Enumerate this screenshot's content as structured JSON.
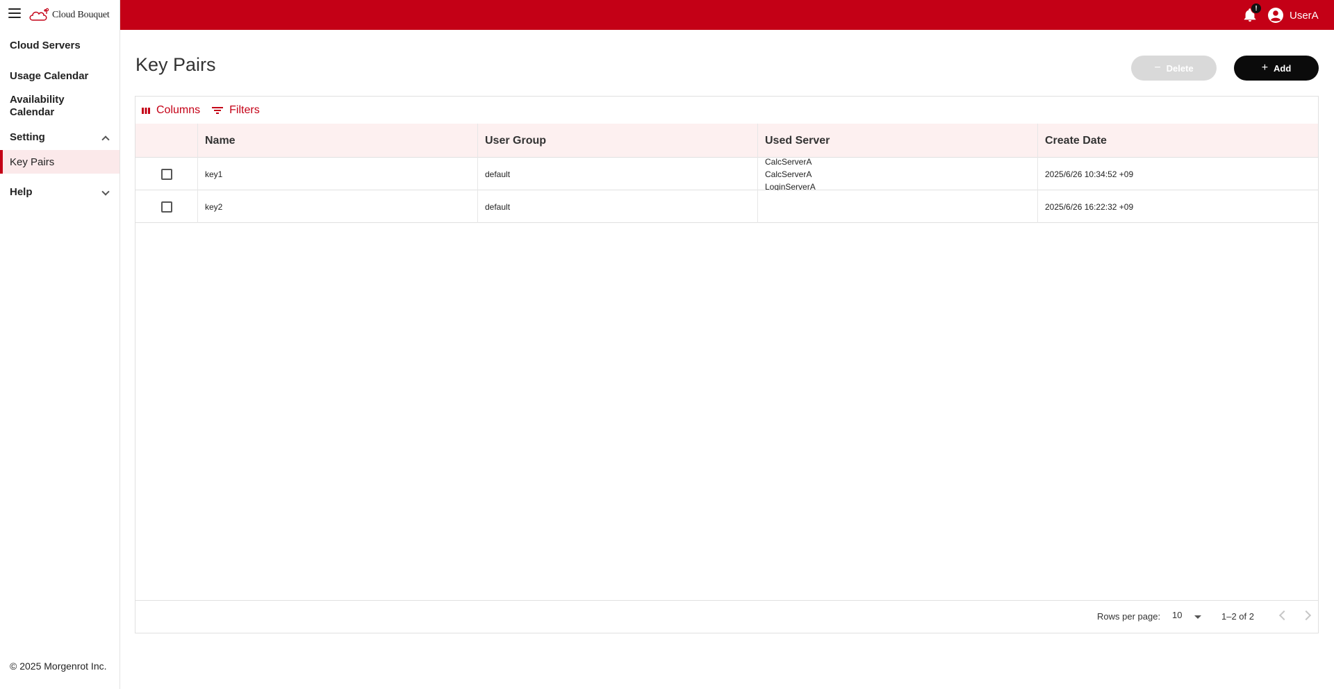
{
  "header": {
    "logo_text": "Cloud Bouquet",
    "notification_badge": "!",
    "user_name": "UserA",
    "brand_color": "#c40016"
  },
  "sidebar": {
    "items": [
      {
        "label": "Cloud Servers"
      },
      {
        "label": "Usage Calendar"
      },
      {
        "label": "Availability Calendar"
      },
      {
        "label": "Setting",
        "expanded": true
      },
      {
        "label": "Key Pairs",
        "selected": true
      },
      {
        "label": "Help",
        "expanded": false
      }
    ],
    "copyright": "© 2025 Morgenrot Inc."
  },
  "main": {
    "title": "Key Pairs",
    "delete_label": "Delete",
    "add_label": "Add",
    "toolbar": {
      "columns_label": "Columns",
      "filters_label": "Filters"
    },
    "table": {
      "columns": [
        "Name",
        "User Group",
        "Used Server",
        "Create Date"
      ],
      "rows": [
        {
          "name": "key1",
          "user_group": "default",
          "used_servers": [
            "CalcServerA",
            "CalcServerA",
            "LoginServerA"
          ],
          "create_date": "2025/6/26 10:34:52 +09"
        },
        {
          "name": "key2",
          "user_group": "default",
          "used_servers": [],
          "create_date": "2025/6/26 16:22:32 +09"
        }
      ]
    },
    "footer": {
      "rows_per_page_label": "Rows per page:",
      "rows_per_page_value": "10",
      "page_range": "1–2 of 2"
    }
  }
}
